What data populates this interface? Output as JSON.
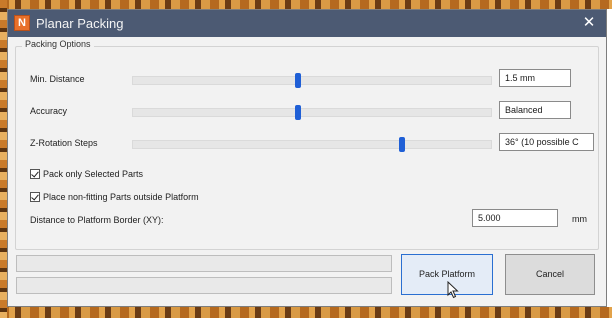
{
  "window": {
    "title": "Planar Packing",
    "app_icon": "app-logo-icon",
    "close_icon": "close-icon",
    "close_glyph": "✕"
  },
  "options": {
    "legend": "Packing Options",
    "sliders": [
      {
        "label": "Min. Distance",
        "value": "1.5 mm",
        "level": 0.46
      },
      {
        "label": "Accuracy",
        "value": "Balanced",
        "level": 0.46
      },
      {
        "label": "Z-Rotation Steps",
        "value": "36° (10 possible C",
        "level": 0.75
      }
    ],
    "checkboxes": [
      {
        "label": "Pack only Selected Parts",
        "checked": true
      },
      {
        "label": "Place non-fitting Parts outside Platform",
        "checked": true
      }
    ],
    "border_distance": {
      "label": "Distance to Platform Border (XY):",
      "value": "5.000",
      "unit": "mm"
    }
  },
  "progress": {
    "bars": [
      0,
      0
    ]
  },
  "actions": {
    "pack_label": "Pack Platform",
    "cancel_label": "Cancel"
  },
  "colors": {
    "titlebar": "#4c5a73",
    "slider_thumb": "#1f5fd6",
    "primary_border": "#2a6fd1"
  }
}
